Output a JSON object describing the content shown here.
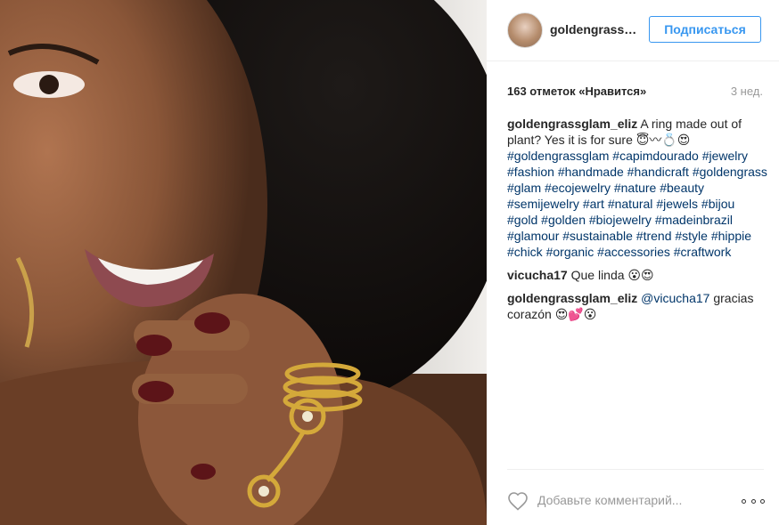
{
  "post": {
    "username": "goldengrass…",
    "follow_label": "Подписаться",
    "likes": "163 отметок «Нравится»",
    "time": "3 нед."
  },
  "comments": [
    {
      "user": "goldengrassglam_eliz",
      "text": "A ring made out of plant? Yes it is for sure 😇〰💍😍",
      "hashtags": [
        "#goldengrassglam",
        "#capimdourado",
        "#jewelry",
        "#fashion",
        "#handmade",
        "#handicraft",
        "#goldengrass",
        "#glam",
        "#ecojewelry",
        "#nature",
        "#beauty",
        "#semijewelry",
        "#art",
        "#natural",
        "#jewels",
        "#bijou",
        "#gold",
        "#golden",
        "#biojewelry",
        "#madeinbrazil",
        "#glamour",
        "#sustainable",
        "#trend",
        "#style",
        "#hippie",
        "#chick",
        "#organic",
        "#accessories",
        "#craftwork"
      ]
    },
    {
      "user": "vicucha17",
      "text": "Que linda 😮😍"
    },
    {
      "user": "goldengrassglam_eliz",
      "mention": "@vicucha17",
      "text": "gracias corazón 😍💕😮"
    }
  ],
  "footer": {
    "comment_placeholder": "Добавьте комментарий...",
    "heart_icon": "heart-outline-icon",
    "more_icon": "more-options-icon"
  },
  "colors": {
    "accent": "#3897f0",
    "hashtag": "#003569",
    "muted": "#999999"
  }
}
